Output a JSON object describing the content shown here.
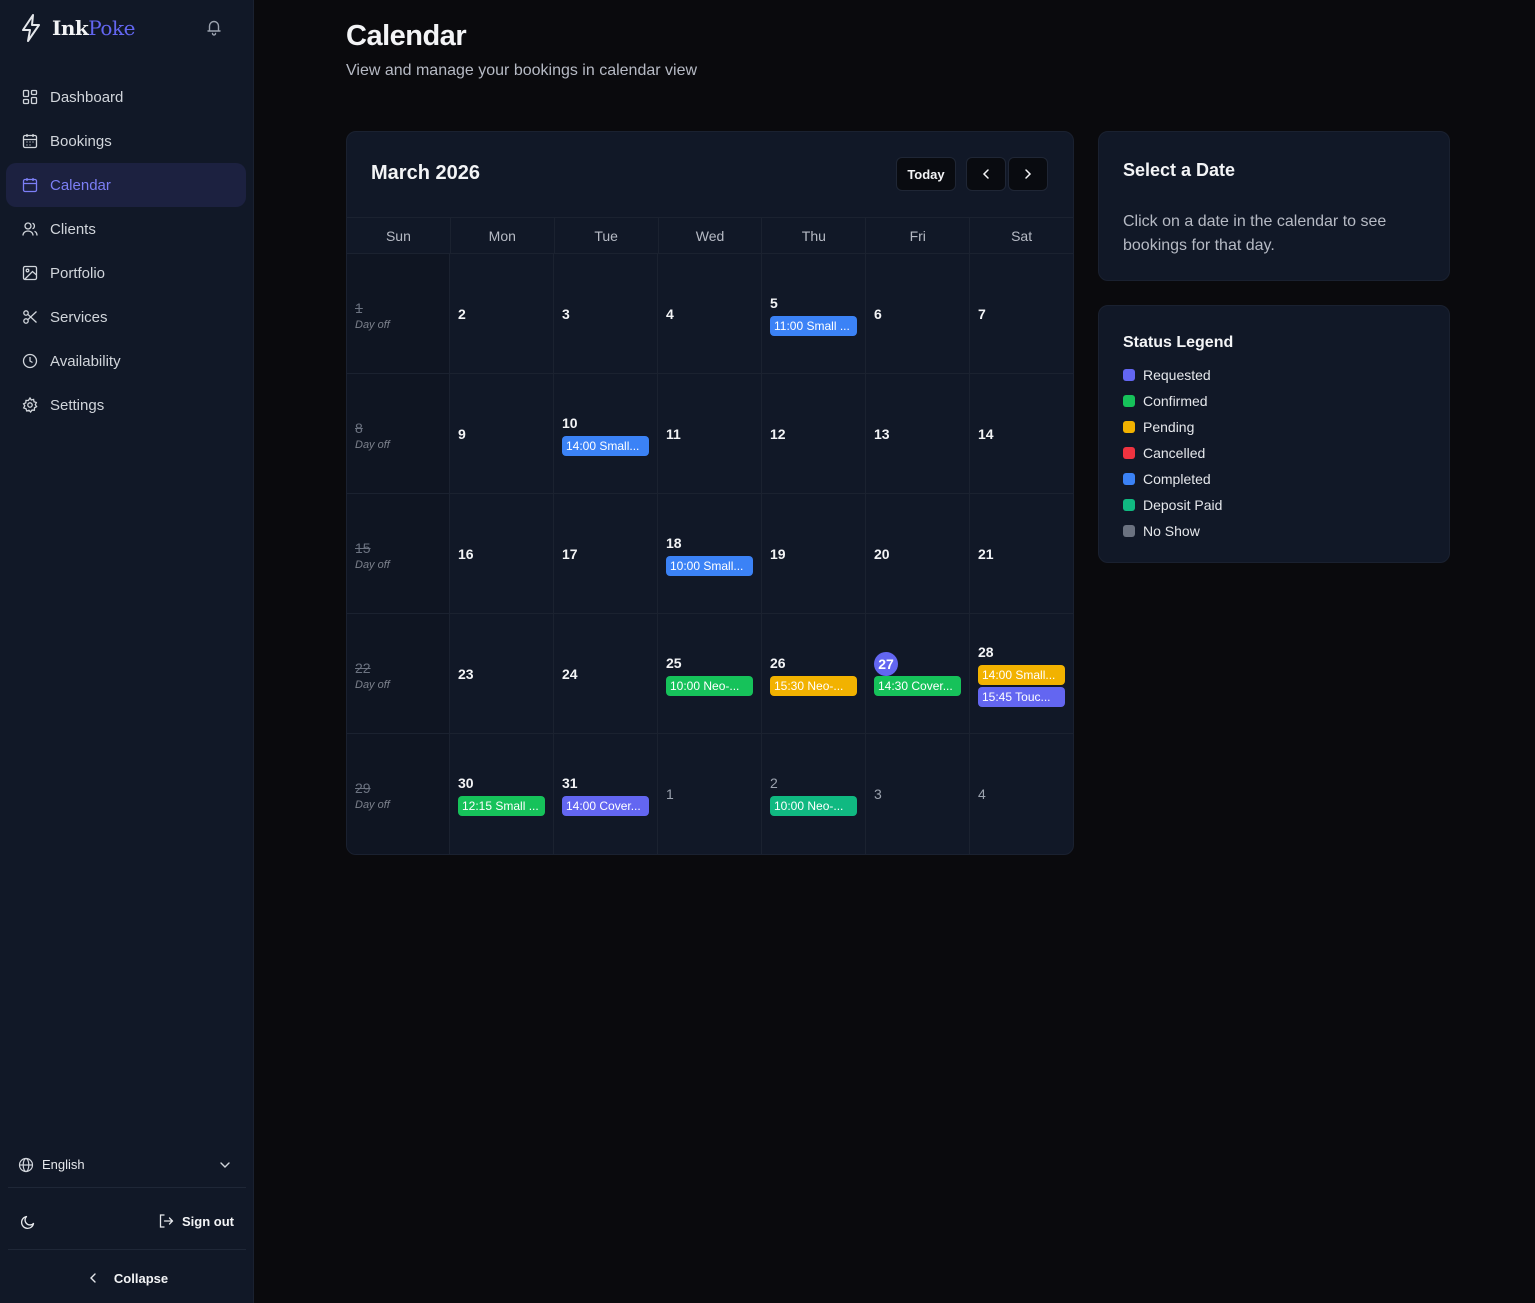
{
  "app": {
    "brand_part1": "Ink",
    "brand_part2": "Poke",
    "accent_color": "#6366f1",
    "icons": {
      "logo": "lightning-icon",
      "notifications": "bell-icon"
    }
  },
  "sidebar": {
    "items": [
      {
        "label": "Dashboard",
        "icon": "grid-icon",
        "active": false
      },
      {
        "label": "Bookings",
        "icon": "calendar-grid-icon",
        "active": false
      },
      {
        "label": "Calendar",
        "icon": "calendar-icon",
        "active": true
      },
      {
        "label": "Clients",
        "icon": "users-icon",
        "active": false
      },
      {
        "label": "Portfolio",
        "icon": "image-icon",
        "active": false
      },
      {
        "label": "Services",
        "icon": "scissors-icon",
        "active": false
      },
      {
        "label": "Availability",
        "icon": "clock-icon",
        "active": false
      },
      {
        "label": "Settings",
        "icon": "gear-icon",
        "active": false
      }
    ],
    "language": "English",
    "sign_out": "Sign out",
    "collapse": "Collapse"
  },
  "header": {
    "title": "Calendar",
    "subtitle": "View and manage your bookings in calendar view"
  },
  "calendar": {
    "month_label": "March 2026",
    "today_button": "Today",
    "weekdays": [
      "Sun",
      "Mon",
      "Tue",
      "Wed",
      "Thu",
      "Fri",
      "Sat"
    ],
    "day_off_label": "Day off",
    "weeks": [
      [
        {
          "day": "1",
          "day_off": true,
          "events": []
        },
        {
          "day": "2",
          "events": []
        },
        {
          "day": "3",
          "events": []
        },
        {
          "day": "4",
          "events": []
        },
        {
          "day": "5",
          "events": [
            {
              "text": "11:00 Small ...",
              "status": "completed"
            }
          ]
        },
        {
          "day": "6",
          "events": []
        },
        {
          "day": "7",
          "events": []
        }
      ],
      [
        {
          "day": "8",
          "day_off": true,
          "events": []
        },
        {
          "day": "9",
          "events": []
        },
        {
          "day": "10",
          "events": [
            {
              "text": "14:00 Small...",
              "status": "completed"
            }
          ]
        },
        {
          "day": "11",
          "events": []
        },
        {
          "day": "12",
          "events": []
        },
        {
          "day": "13",
          "events": []
        },
        {
          "day": "14",
          "events": []
        }
      ],
      [
        {
          "day": "15",
          "day_off": true,
          "events": []
        },
        {
          "day": "16",
          "events": []
        },
        {
          "day": "17",
          "events": []
        },
        {
          "day": "18",
          "events": [
            {
              "text": "10:00 Small...",
              "status": "completed"
            }
          ]
        },
        {
          "day": "19",
          "events": []
        },
        {
          "day": "20",
          "events": []
        },
        {
          "day": "21",
          "events": []
        }
      ],
      [
        {
          "day": "22",
          "day_off": true,
          "events": []
        },
        {
          "day": "23",
          "events": []
        },
        {
          "day": "24",
          "events": []
        },
        {
          "day": "25",
          "events": [
            {
              "text": "10:00 Neo-...",
              "status": "confirmed"
            }
          ]
        },
        {
          "day": "26",
          "events": [
            {
              "text": "15:30 Neo-...",
              "status": "pending"
            }
          ]
        },
        {
          "day": "27",
          "today": true,
          "events": [
            {
              "text": "14:30 Cover...",
              "status": "confirmed"
            }
          ]
        },
        {
          "day": "28",
          "events": [
            {
              "text": "14:00 Small...",
              "status": "pending"
            },
            {
              "text": "15:45 Touc...",
              "status": "requested"
            }
          ]
        }
      ],
      [
        {
          "day": "29",
          "day_off": true,
          "events": []
        },
        {
          "day": "30",
          "events": [
            {
              "text": "12:15 Small ...",
              "status": "confirmed"
            }
          ]
        },
        {
          "day": "31",
          "events": [
            {
              "text": "14:00 Cover...",
              "status": "requested"
            }
          ]
        },
        {
          "day": "1",
          "other_month": true,
          "events": []
        },
        {
          "day": "2",
          "other_month": true,
          "events": [
            {
              "text": "10:00 Neo-...",
              "status": "deposit"
            }
          ]
        },
        {
          "day": "3",
          "other_month": true,
          "events": []
        },
        {
          "day": "4",
          "other_month": true,
          "events": []
        }
      ]
    ]
  },
  "select_panel": {
    "title": "Select a Date",
    "description": "Click on a date in the calendar to see bookings for that day."
  },
  "legend": {
    "title": "Status Legend",
    "items": [
      {
        "label": "Requested",
        "color": "#6366f1"
      },
      {
        "label": "Confirmed",
        "color": "#16c25a"
      },
      {
        "label": "Pending",
        "color": "#f2b200"
      },
      {
        "label": "Cancelled",
        "color": "#ef3340"
      },
      {
        "label": "Completed",
        "color": "#3b82f6"
      },
      {
        "label": "Deposit Paid",
        "color": "#10b981"
      },
      {
        "label": "No Show",
        "color": "#6b7280"
      }
    ]
  }
}
